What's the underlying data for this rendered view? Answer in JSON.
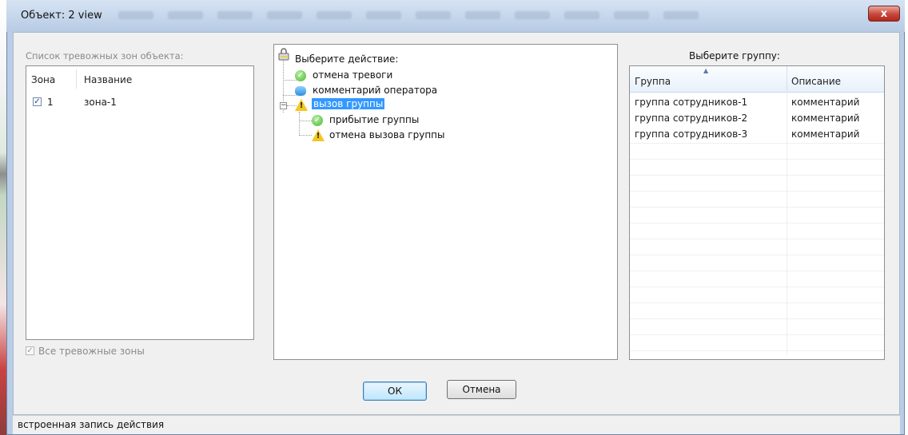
{
  "window": {
    "title": "Объект: 2 view",
    "close_symbol": "x"
  },
  "zones": {
    "caption": "Список тревожных зон объекта:",
    "columns": [
      "Зона",
      "Название"
    ],
    "rows": [
      {
        "checked": true,
        "zone": "1",
        "name": "зона-1"
      }
    ],
    "all_zones_label": "Все тревожные зоны",
    "all_zones_checked": true
  },
  "actions": {
    "root_label": "Выберите действие:",
    "nodes": [
      {
        "label": "отмена тревоги",
        "icon": "check-circle-icon"
      },
      {
        "label": "комментарий оператора",
        "icon": "comment-icon"
      },
      {
        "label": "вызов группы",
        "icon": "warning-icon",
        "selected": true,
        "expanded": true,
        "children": [
          {
            "label": "прибытие группы",
            "icon": "check-circle-icon"
          },
          {
            "label": "отмена вызова группы",
            "icon": "warning-icon"
          }
        ]
      }
    ]
  },
  "groups": {
    "title": "Выберите группу:",
    "columns": [
      "Группа",
      "Описание"
    ],
    "rows": [
      {
        "group": "группа сотрудников-1",
        "description": "комментарий"
      },
      {
        "group": "группа сотрудников-2",
        "description": "комментарий"
      },
      {
        "group": "группа сотрудников-3",
        "description": "комментарий"
      }
    ]
  },
  "buttons": {
    "ok": "ОК",
    "cancel": "Отмена"
  },
  "status": {
    "text": "встроенная запись действия"
  }
}
